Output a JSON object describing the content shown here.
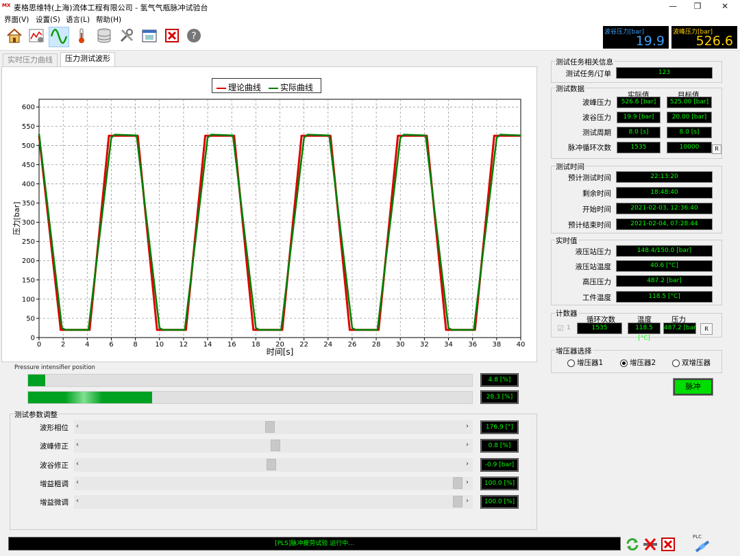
{
  "window": {
    "title": "麦格思维特(上海)流体工程有限公司 - 氢气气瓶脉冲试验台",
    "minimize": "—",
    "maximize": "❐",
    "close": "✕",
    "logo": "MX"
  },
  "menu": [
    "界面(V)",
    "设置(S)",
    "语言(L)",
    "帮助(H)"
  ],
  "toolbar": {
    "icons": [
      "home-icon",
      "chart-settings-icon",
      "wave-icon",
      "thermometer-icon",
      "database-icon",
      "tools-icon",
      "window-icon",
      "close-red-icon",
      "help-icon"
    ]
  },
  "readouts": {
    "valley": {
      "label": "波谷压力[bar]",
      "value": "19.9",
      "color": "#3aa0ff"
    },
    "peak": {
      "label": "波峰压力[bar]",
      "value": "526.6",
      "color": "#ffd000"
    }
  },
  "tabs": [
    "实时压力曲线",
    "压力测试波形"
  ],
  "chart_data": {
    "type": "line",
    "xlabel": "时间[s]",
    "ylabel": "压力[bar]",
    "xlim": [
      0,
      40
    ],
    "ylim": [
      0,
      620
    ],
    "xticks": [
      0,
      2,
      4,
      6,
      8,
      10,
      12,
      14,
      16,
      18,
      20,
      22,
      24,
      26,
      28,
      30,
      32,
      34,
      36,
      38,
      40
    ],
    "yticks": [
      0,
      50,
      100,
      150,
      200,
      250,
      300,
      350,
      400,
      450,
      500,
      550,
      600
    ],
    "grid": true,
    "legend_position": "top-center",
    "series": [
      {
        "name": "理论曲线",
        "color": "#e00000",
        "x": [
          0,
          1.8,
          4.2,
          5.8,
          8.2,
          9.8,
          12.2,
          13.8,
          16.2,
          17.8,
          20.2,
          21.8,
          24.2,
          25.8,
          28.2,
          29.8,
          32.2,
          33.8,
          36.2,
          37.8,
          40
        ],
        "y": [
          525,
          20,
          20,
          525,
          525,
          20,
          20,
          525,
          525,
          20,
          20,
          525,
          525,
          20,
          20,
          525,
          525,
          20,
          20,
          525,
          525
        ]
      },
      {
        "name": "实际曲线",
        "color": "#008000",
        "x": [
          0,
          1.9,
          2.2,
          4.1,
          6.0,
          6.3,
          8.1,
          10.0,
          10.3,
          12.1,
          14.0,
          14.3,
          16.1,
          18.0,
          18.3,
          20.1,
          22.0,
          22.3,
          24.1,
          26.0,
          26.3,
          28.1,
          30.0,
          30.3,
          32.1,
          34.0,
          34.3,
          36.1,
          38.0,
          38.3,
          40
        ],
        "y": [
          530,
          25,
          20,
          20,
          520,
          528,
          526,
          25,
          20,
          20,
          520,
          528,
          526,
          25,
          20,
          20,
          520,
          528,
          526,
          25,
          20,
          20,
          520,
          528,
          526,
          25,
          20,
          20,
          520,
          528,
          526
        ]
      }
    ]
  },
  "intensifier": {
    "title": "Pressure intensifier position",
    "bars": [
      {
        "value": "4.8 [%]",
        "fill": 0.038,
        "style": "solid"
      },
      {
        "value": "28.3 [%]",
        "fill": 0.28,
        "style": "glow"
      }
    ]
  },
  "params": {
    "title": "测试参数调整",
    "rows": [
      {
        "label": "波形相位",
        "value": "176.9 [°]",
        "pos": 0.49
      },
      {
        "label": "波峰修正",
        "value": "0.8 [%]",
        "pos": 0.505
      },
      {
        "label": "波谷修正",
        "value": "-0.9 [bar]",
        "pos": 0.495
      },
      {
        "label": "增益粗调",
        "value": "100.0 [%]",
        "pos": 1.0
      },
      {
        "label": "增益微调",
        "value": "100.0 [%]",
        "pos": 1.0
      }
    ]
  },
  "right": {
    "task": {
      "title": "测试任务相关信息",
      "label": "测试任务/订单",
      "value": "123"
    },
    "testdata": {
      "title": "测试数据",
      "col1": "实际值",
      "col2": "目标值",
      "reset": "R",
      "rows": [
        {
          "label": "波峰压力",
          "actual": "526.6 [bar]",
          "target": "525.00 [bar]"
        },
        {
          "label": "波谷压力",
          "actual": "19.9 [bar]",
          "target": "20.00 [bar]"
        },
        {
          "label": "测试周期",
          "actual": "8.0 [s]",
          "target": "8.0 [s]"
        },
        {
          "label": "脉冲循环次数",
          "actual": "1535",
          "target": "10000"
        }
      ]
    },
    "time": {
      "title": "测试时间",
      "rows": [
        {
          "label": "预计测试时间",
          "value": "22:13:20"
        },
        {
          "label": "剩余时间",
          "value": "18:48:40"
        },
        {
          "label": "开始时间",
          "value": "2021-02-03, 12:36:40"
        },
        {
          "label": "预计结束时间",
          "value": "2021-02-04, 07:28:44"
        }
      ]
    },
    "realtime": {
      "title": "实时值",
      "rows": [
        {
          "label": "液压站压力",
          "value": "148.4/150.0 [bar]"
        },
        {
          "label": "液压站温度",
          "value": "40.6 [°C]"
        },
        {
          "label": "高压压力",
          "value": "487.2 [bar]"
        },
        {
          "label": "工件温度",
          "value": "118.5 [°C]"
        }
      ]
    },
    "counter": {
      "title": "计数器",
      "check": "☑",
      "check_label": "1",
      "h1": "循环次数",
      "h2": "温度",
      "h3": "压力",
      "v1": "1535",
      "v2": "118.5 [°C]",
      "v3": "487.2 [bar]",
      "reset": "R"
    },
    "booster": {
      "title": "增压器选择",
      "options": [
        "增压器1",
        "增压器2",
        "双增压器"
      ],
      "selected": 1
    },
    "pulse": "脉冲"
  },
  "status": {
    "text": "[PLS]脉冲疲劳试验 运行中...",
    "plc": "PLC"
  }
}
